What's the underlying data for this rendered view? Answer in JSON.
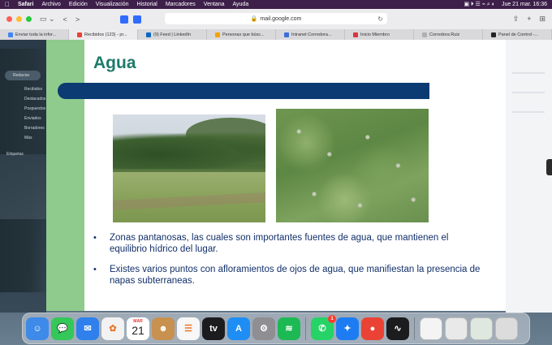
{
  "menubar": {
    "app_name": "Safari",
    "menus": [
      "Archivo",
      "Edición",
      "Visualización",
      "Historial",
      "Marcadores",
      "Ventana",
      "Ayuda"
    ],
    "datetime": "Jue 21 mar.  16:36"
  },
  "browser": {
    "url": "mail.google.com",
    "tabs": [
      {
        "label": "Enviar toda la infor...",
        "favicon_color": "#4285f4"
      },
      {
        "label": "Recibidos (123) - pr...",
        "favicon_color": "#ea4335"
      },
      {
        "label": "(9) Feed | LinkedIn",
        "favicon_color": "#0a66c2"
      },
      {
        "label": "Personas que búsc...",
        "favicon_color": "#f4a300"
      },
      {
        "label": "Intranet Corredora...",
        "favicon_color": "#3b6fd8"
      },
      {
        "label": "Inicio Miembro",
        "favicon_color": "#d9363e"
      },
      {
        "label": "Corredora Ruiz",
        "favicon_color": "#b0b0b0"
      },
      {
        "label": "Panel de Control -...",
        "favicon_color": "#222222"
      }
    ]
  },
  "gmail": {
    "compose": "Redactar",
    "items": [
      "Recibidos",
      "Destacados",
      "Pospuestos",
      "Enviados",
      "Borradores",
      "Más",
      "Etiquetas"
    ]
  },
  "slide": {
    "title": "Agua",
    "bullets": [
      "Zonas pantanosas, las cuales son importantes fuentes de agua, que mantienen el equilibrio hídrico del lugar.",
      "Existes varios puntos con afloramientos de ojos de agua, que manifiestan la presencia de napas subterraneas."
    ],
    "bullet_glyph": "•",
    "colors": {
      "title": "#1d7a6a",
      "bar": "#0b3b72",
      "sidebar": "#8fcb8d",
      "text": "#12306a"
    }
  },
  "dock": {
    "apps": [
      {
        "name": "finder-icon",
        "color": "#3d8ae8",
        "glyph": "☺"
      },
      {
        "name": "messages-icon",
        "color": "#34c759",
        "glyph": "💬"
      },
      {
        "name": "mail-icon",
        "color": "#2f80ed",
        "glyph": "✉"
      },
      {
        "name": "photos-icon",
        "color": "#f2f2f2",
        "glyph": "✿"
      },
      {
        "name": "calendar-icon",
        "color": "#ffffff",
        "glyph": ""
      },
      {
        "name": "contacts-icon",
        "color": "#c8914f",
        "glyph": "☻"
      },
      {
        "name": "reminders-icon",
        "color": "#f7f7f7",
        "glyph": "☰"
      },
      {
        "name": "tv-icon",
        "color": "#1c1c1e",
        "glyph": "tv"
      },
      {
        "name": "app-store-icon",
        "color": "#1e8ef5",
        "glyph": "A"
      },
      {
        "name": "system-settings-icon",
        "color": "#8e8e93",
        "glyph": "⚙"
      },
      {
        "name": "spotify-icon",
        "color": "#1db954",
        "glyph": "≋"
      }
    ],
    "calendar": {
      "month": "MAR",
      "day": "21"
    },
    "recent_apps": [
      {
        "name": "whatsapp-icon",
        "color": "#25d366",
        "glyph": "✆",
        "badge": "1"
      },
      {
        "name": "safari-icon",
        "color": "#1e7cf2",
        "glyph": "✦"
      },
      {
        "name": "chrome-icon",
        "color": "#ea4335",
        "glyph": "●"
      },
      {
        "name": "voice-memos-icon",
        "color": "#1c1c1e",
        "glyph": "∿"
      }
    ],
    "stack_items": [
      {
        "name": "document-thumbnail-icon",
        "color": "#f4f4f4"
      },
      {
        "name": "screenshot-thumbnail-icon",
        "color": "#e9e9e9"
      },
      {
        "name": "whatsapp-thumbnail-icon",
        "color": "#dfe8df"
      },
      {
        "name": "trash-icon",
        "color": "#dcdcdc"
      }
    ]
  }
}
